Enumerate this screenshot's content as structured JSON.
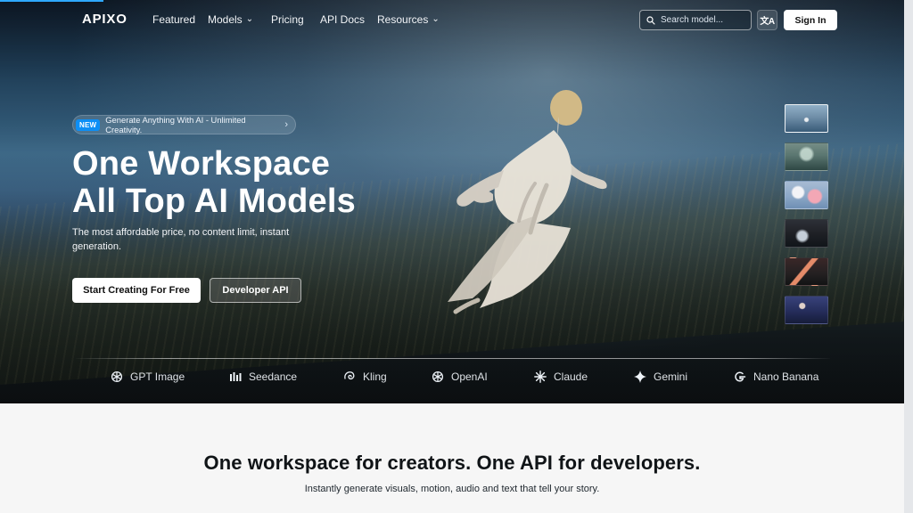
{
  "nav": {
    "logo": "APIXO",
    "items": [
      {
        "label": "Featured"
      },
      {
        "label": "Models",
        "dropdown": true
      },
      {
        "label": "Pricing"
      },
      {
        "label": "API Docs"
      },
      {
        "label": "Resources",
        "dropdown": true
      }
    ],
    "search_placeholder": "Search model...",
    "signin_label": "Sign In"
  },
  "hero": {
    "badge": "NEW",
    "announcement": "Generate Anything With AI - Unlimited Creativity.",
    "title_line1": "One Workspace",
    "title_line2": "All Top AI Models",
    "subtitle": "The most affordable price, no content limit, instant generation.",
    "primary_cta": "Start Creating For Free",
    "secondary_cta": "Developer API"
  },
  "models_strip": [
    {
      "label": "GPT Image",
      "icon": "openai-icon"
    },
    {
      "label": "Seedance",
      "icon": "bars-icon"
    },
    {
      "label": "Kling",
      "icon": "swirl-icon"
    },
    {
      "label": "OpenAI",
      "icon": "openai-icon"
    },
    {
      "label": "Claude",
      "icon": "asterisk-icon"
    },
    {
      "label": "Gemini",
      "icon": "sparkle-icon"
    },
    {
      "label": "Nano Banana",
      "icon": "google-g-icon"
    }
  ],
  "bottom": {
    "title": "One workspace for creators. One API for developers.",
    "subtitle": "Instantly generate visuals, motion, audio and text that tell your story."
  },
  "colors": {
    "accent": "#0d8ff5",
    "top_progress": "#2ea8ff"
  }
}
